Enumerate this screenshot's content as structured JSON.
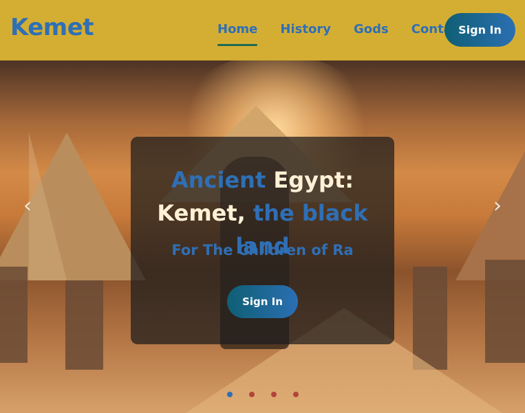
{
  "brand": {
    "name": "Kemet"
  },
  "nav": {
    "items": [
      {
        "label": "Home",
        "active": true
      },
      {
        "label": "History",
        "active": false
      },
      {
        "label": "Gods",
        "active": false
      },
      {
        "label": "Contact",
        "active": false
      }
    ],
    "signin_label": "Sign In"
  },
  "hero": {
    "headline_part1": "Ancient",
    "headline_part2": " Egypt:",
    "headline_part3": "Kemet,",
    "headline_part4": " the black land",
    "tagline": "For The Children of Ra",
    "cta_label": "Sign In",
    "carousel": {
      "prev_icon": "chevron-left-icon",
      "next_icon": "chevron-right-icon",
      "dots": [
        "#2f6fb5",
        "#b3443b",
        "#b3443b",
        "#b3443b"
      ]
    }
  },
  "colors": {
    "navbar": "#d4ae33",
    "brand_blue": "#2f6fb5",
    "cta_gradient_start": "#0f5f74",
    "cta_gradient_end": "#2b6fb3"
  }
}
